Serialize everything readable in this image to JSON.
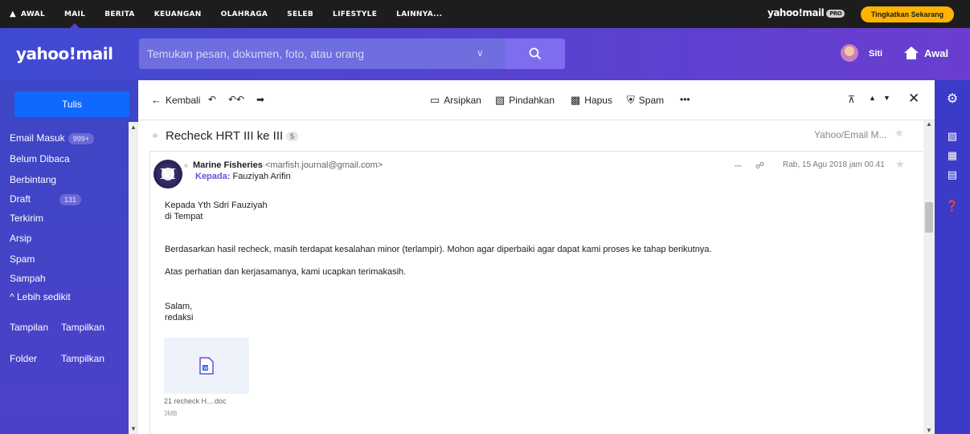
{
  "topnav": {
    "items": [
      "AWAL",
      "MAIL",
      "BERITA",
      "KEUANGAN",
      "OLAHRAGA",
      "SELEB",
      "LIFESTYLE",
      "LAINNYA..."
    ],
    "brand": "yahoo!mail",
    "pro_badge": "PRO",
    "upgrade_label": "Tingkatkan Sekarang",
    "accent_color": "#ffb400"
  },
  "header": {
    "logo": "yahoo!mail",
    "search_placeholder": "Temukan pesan, dokumen, foto, atau orang",
    "user_name": "Siti",
    "home_label": "Awal",
    "gradient_start": "#3f4ad2",
    "gradient_end": "#6a3dd0"
  },
  "sidebar": {
    "compose_label": "Tulis",
    "folders": [
      {
        "label": "Email Masuk",
        "badge": "999+"
      },
      {
        "label": "Belum Dibaca",
        "badge": ""
      },
      {
        "label": "Berbintang",
        "badge": ""
      },
      {
        "label": "Draft",
        "badge": "131"
      },
      {
        "label": "Terkirim",
        "badge": ""
      },
      {
        "label": "Arsip",
        "badge": ""
      },
      {
        "label": "Spam",
        "badge": ""
      },
      {
        "label": "Sampah",
        "badge": ""
      }
    ],
    "less_label": "^ Lebih sedikit",
    "views_label": "Tampilan",
    "views_action": "Tampilkan",
    "folders_label": "Folder",
    "folders_action": "Tampilkan"
  },
  "toolbar": {
    "back_label": "Kembali",
    "archive_label": "Arsipkan",
    "move_label": "Pindahkan",
    "delete_label": "Hapus",
    "spam_label": "Spam",
    "more_label": "•••"
  },
  "email": {
    "subject": "Recheck HRT III ke III",
    "thread_count": "5",
    "folder_tag": "Yahoo/Email M...",
    "sender_name": "Marine Fisheries",
    "sender_email": "<marfish.journal@gmail.com>",
    "to_label": "Kepada:",
    "to_name": "Fauziyah Arifin",
    "date": "Rab, 15 Agu 2018 jam 00.41",
    "body": [
      "Kepada Yth Sdri Fauziyah",
      "di Tempat",
      "Berdasarkan hasil recheck, masih terdapat kesalahan minor (terlampir). Mohon agar diperbaiki agar dapat kami proses ke tahap berikutnya.",
      "Atas perhatian dan kerjasamanya, kami ucapkan terimakasih.",
      "Salam,",
      "redaksi"
    ],
    "attachment_name": "21 recheck H....doc",
    "attachment_size": "3MB"
  }
}
